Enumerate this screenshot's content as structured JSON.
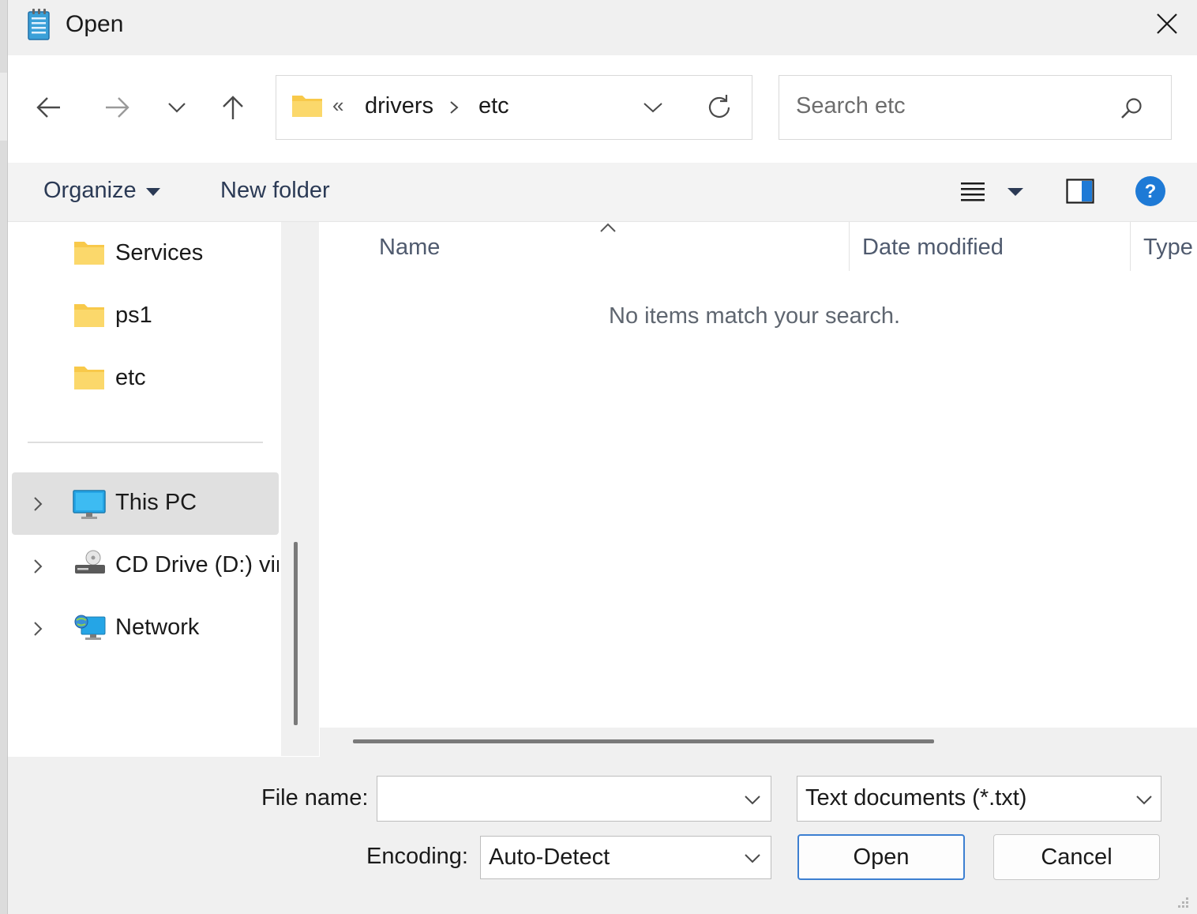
{
  "window": {
    "title": "Open"
  },
  "address": {
    "crumbs": [
      "drivers",
      "etc"
    ],
    "overflow": "«"
  },
  "search": {
    "placeholder": "Search etc"
  },
  "toolbar": {
    "organize": "Organize",
    "new_folder": "New folder"
  },
  "nav": {
    "folders": [
      "Services",
      "ps1",
      "etc"
    ],
    "locations": [
      {
        "label": "This PC",
        "icon": "monitor-icon"
      },
      {
        "label": "CD Drive (D:) vir",
        "icon": "cd-drive-icon"
      },
      {
        "label": "Network",
        "icon": "network-icon"
      }
    ]
  },
  "columns": {
    "name": "Name",
    "date": "Date modified",
    "type": "Type"
  },
  "file_list": {
    "empty_message": "No items match your search."
  },
  "form": {
    "file_name_label": "File name:",
    "file_name_value": "",
    "file_type": "Text documents (*.txt)",
    "encoding_label": "Encoding:",
    "encoding_value": "Auto-Detect",
    "open": "Open",
    "cancel": "Cancel"
  },
  "colors": {
    "accent": "#3c7fd1",
    "folder": "#f8c94a",
    "help": "#1e7ad6"
  }
}
